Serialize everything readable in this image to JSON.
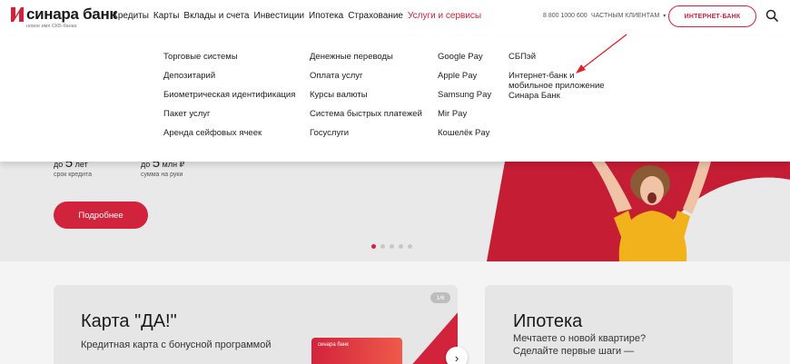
{
  "header": {
    "logo_text": "синара банк",
    "logo_sub": "новое имя СКБ-банка",
    "nav": [
      "Кредиты",
      "Карты",
      "Вклады и счета",
      "Инвестиции",
      "Ипотека",
      "Страхование",
      "Услуги и сервисы"
    ],
    "active_nav": "Услуги и сервисы",
    "phone": "8 800 1000 600",
    "clients": "ЧАСТНЫМ КЛИЕНТАМ",
    "internet_bank_button": "ИНТЕРНЕТ-БАНК"
  },
  "dropdown": {
    "col1": [
      "Торговые системы",
      "Депозитарий",
      "Биометрическая идентификация",
      "Пакет услуг",
      "Аренда сейфовых ячеек"
    ],
    "col2": [
      "Денежные переводы",
      "Оплата услуг",
      "Курсы валюты",
      "Система быстрых платежей",
      "Госуслуги"
    ],
    "col3": [
      "Google Pay",
      "Apple Pay",
      "Samsung Pay",
      "Mir Pay",
      "Кошелёк Pay"
    ],
    "col4": [
      "СБПэй",
      "Интернет-банк и мобильное приложение Синара Банк"
    ]
  },
  "hero": {
    "stat1_pre": "до",
    "stat1_value": "5",
    "stat1_unit": "лет",
    "stat1_caption": "срок кредита",
    "stat2_pre": "до",
    "stat2_value": "5",
    "stat2_unit": "млн ₽",
    "stat2_caption": "сумма на руки",
    "more_button": "Подробнее",
    "slides_total": 5,
    "slide_active": 1
  },
  "cards": {
    "card1_title": "Карта \"ДА!\"",
    "card1_sub": "Кредитная карта с бонусной программой",
    "card1_badge": "1/6",
    "card1_img_text": "синара банк",
    "card2_title": "Ипотека",
    "card2_sub": "Мечтаете о новой квартире? Сделайте первые шаги —"
  },
  "colors": {
    "accent": "#d2233c",
    "background": "#f4f4f4"
  }
}
